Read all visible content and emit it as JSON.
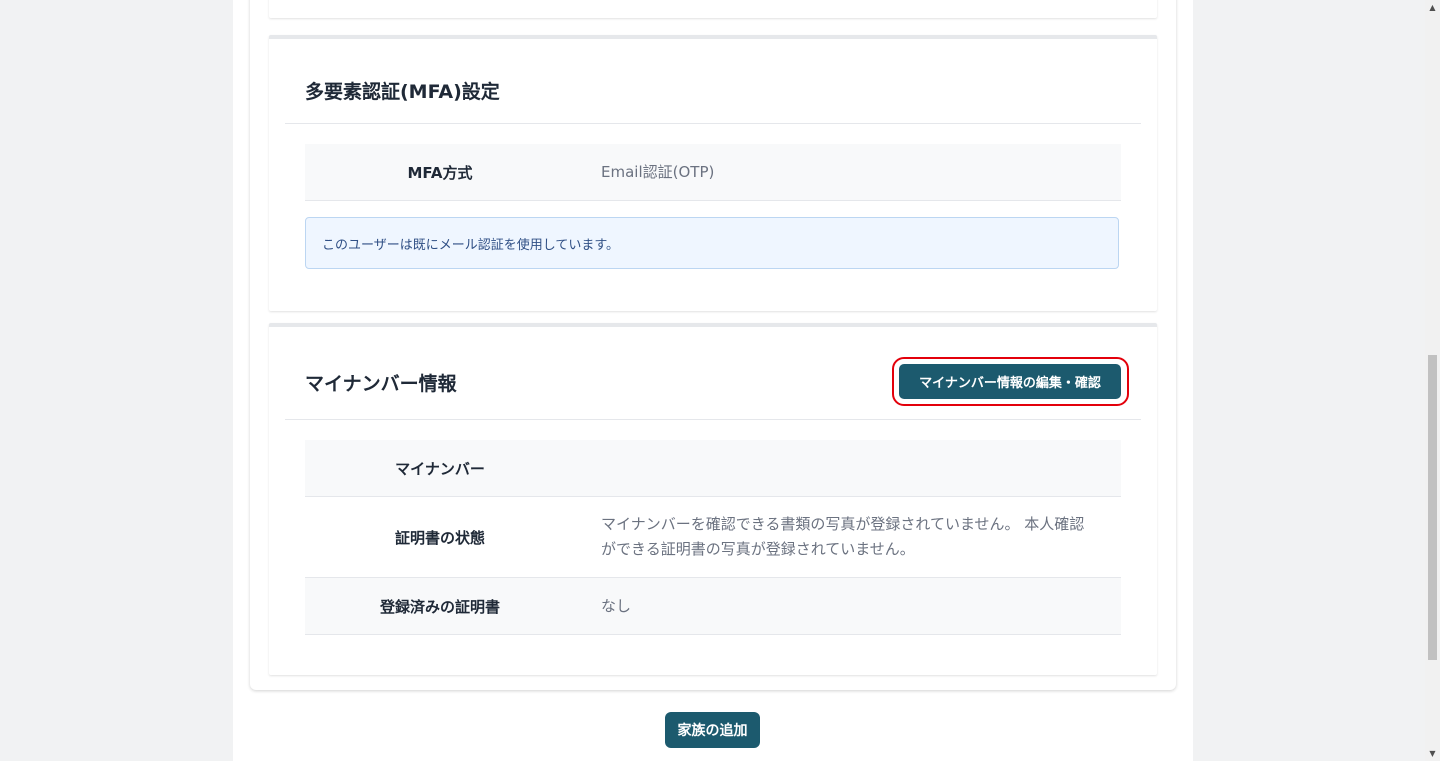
{
  "mfa_section": {
    "title": "多要素認証(MFA)設定",
    "rows": [
      {
        "label": "MFA方式",
        "value": "Email認証(OTP)"
      }
    ],
    "alert": "このユーザーは既にメール認証を使用しています。"
  },
  "mynumber_section": {
    "title": "マイナンバー情報",
    "edit_button_label": "マイナンバー情報の編集・確認",
    "rows": [
      {
        "label": "マイナンバー",
        "value": ""
      },
      {
        "label": "証明書の状態",
        "value": "マイナンバーを確認できる書類の写真が登録されていません。 本人確認ができる証明書の写真が登録されていません。"
      },
      {
        "label": "登録済みの証明書",
        "value": "なし"
      }
    ]
  },
  "footer": {
    "add_family_label": "家族の追加"
  },
  "scrollbar": {
    "up_icon": "triangle-up-icon",
    "down_icon": "triangle-down-icon"
  },
  "colors": {
    "primary_button": "#1c5a6e",
    "highlight_outline": "#e3000b",
    "alert_background": "#eff6ff",
    "alert_text": "#2f4f85"
  }
}
